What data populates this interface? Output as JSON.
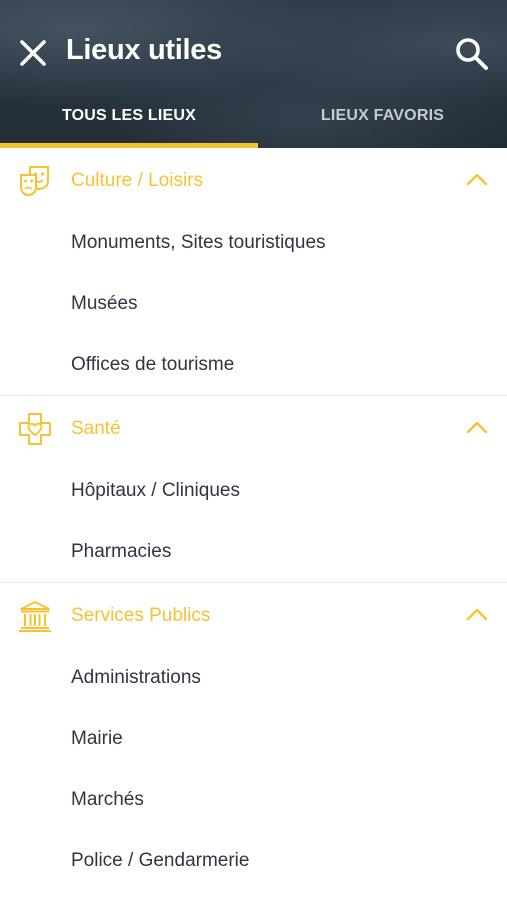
{
  "header": {
    "title": "Lieux utiles",
    "close_icon": "close-icon",
    "search_icon": "search-icon"
  },
  "tabs": [
    {
      "label": "TOUS LES LIEUX",
      "active": true
    },
    {
      "label": "LIEUX FAVORIS",
      "active": false
    }
  ],
  "colors": {
    "accent": "#f6c232",
    "header_bg": "#26323e",
    "text": "#2f3542"
  },
  "sections": [
    {
      "title": "Culture / Loisirs",
      "icon": "theater-masks-icon",
      "expanded": true,
      "items": [
        "Monuments, Sites touristiques",
        "Musées",
        "Offices de tourisme"
      ]
    },
    {
      "title": "Santé",
      "icon": "health-cross-heart-icon",
      "expanded": true,
      "items": [
        "Hôpitaux / Cliniques",
        "Pharmacies"
      ]
    },
    {
      "title": "Services Publics",
      "icon": "public-building-icon",
      "expanded": true,
      "items": [
        "Administrations",
        "Mairie",
        "Marchés",
        "Police / Gendarmerie"
      ]
    }
  ]
}
